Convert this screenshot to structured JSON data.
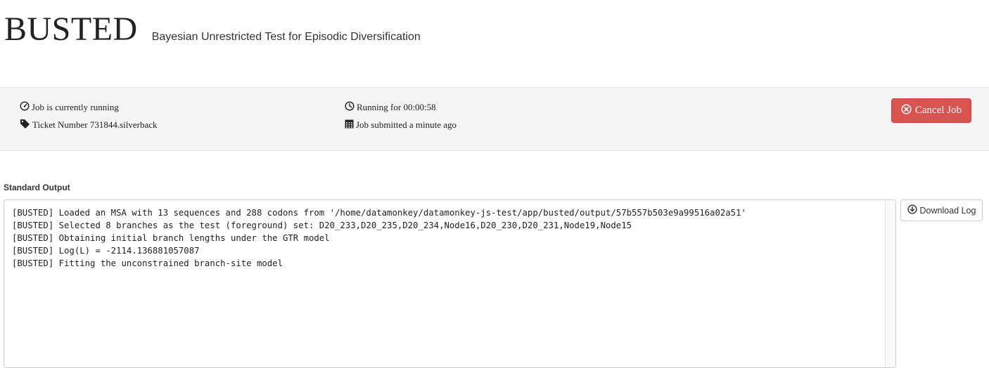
{
  "header": {
    "title": "BUSTED",
    "subtitle": "Bayesian Unrestricted Test for Episodic Diversification"
  },
  "status": {
    "state_text": "Job is currently running",
    "ticket_text": "Ticket Number 731844.silverback",
    "running_text": "Running for 00:00:58",
    "submitted_text": "Job submitted a minute ago",
    "icons": {
      "state": "dashboard-gauge-icon",
      "ticket": "tag-icon",
      "running": "clock-icon",
      "submitted": "calendar-icon"
    }
  },
  "actions": {
    "cancel_label": "Cancel Job",
    "cancel_icon": "circle-x-icon",
    "cancel_color": "#d9534f",
    "download_label": "Download Log",
    "download_icon": "circle-download-icon"
  },
  "output": {
    "label": "Standard Output",
    "log_text": "[BUSTED] Loaded an MSA with 13 sequences and 288 codons from '/home/datamonkey/datamonkey-js-test/app/busted/output/57b557b503e9a99516a02a51'\n[BUSTED] Selected 8 branches as the test (foreground) set: D20_233,D20_235,D20_234,Node16,D20_230,D20_231,Node19,Node15\n[BUSTED] Obtaining initial branch lengths under the GTR model\n[BUSTED] Log(L) = -2114.136881057087\n[BUSTED] Fitting the unconstrained branch-site model"
  }
}
